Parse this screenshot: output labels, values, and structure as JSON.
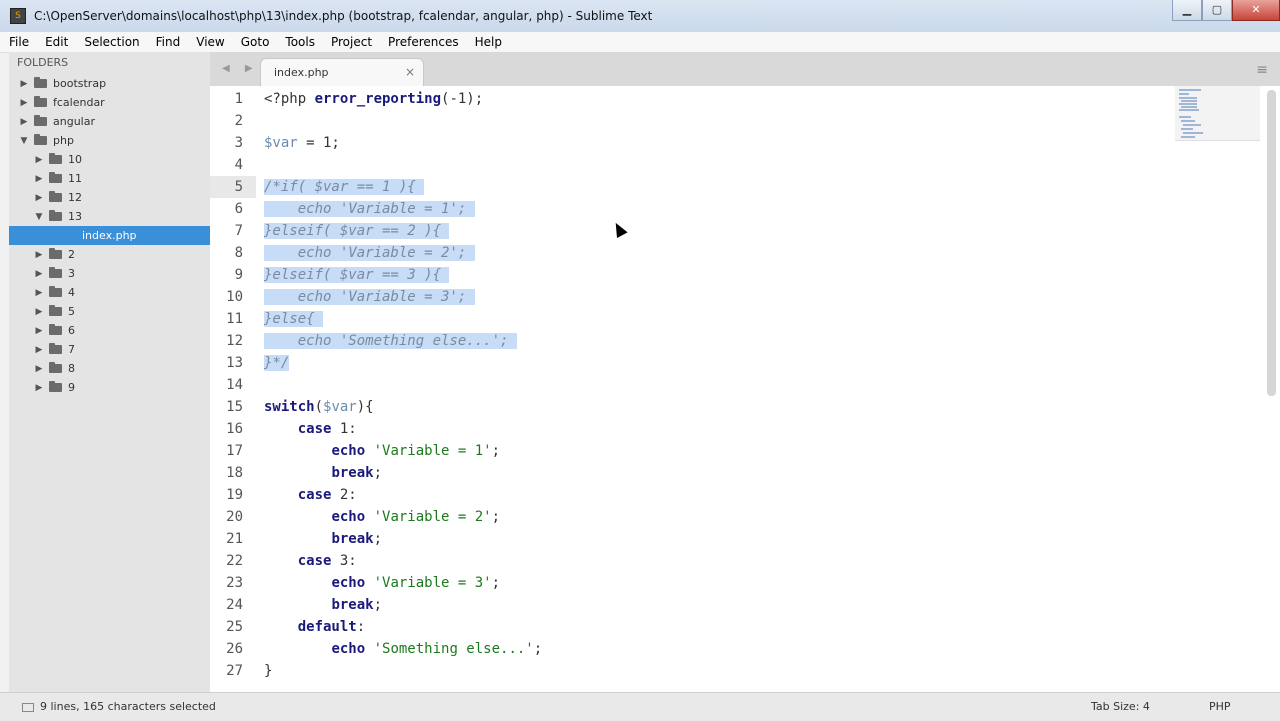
{
  "window": {
    "title": "C:\\OpenServer\\domains\\localhost\\php\\13\\index.php (bootstrap, fcalendar, angular, php) - Sublime Text",
    "minimize_glyph": "▁",
    "maximize_glyph": "▢",
    "close_glyph": "✕"
  },
  "menu": [
    "File",
    "Edit",
    "Selection",
    "Find",
    "View",
    "Goto",
    "Tools",
    "Project",
    "Preferences",
    "Help"
  ],
  "sidebar": {
    "header": "FOLDERS",
    "items": [
      {
        "label": "bootstrap",
        "level": 0,
        "expanded": false,
        "type": "folder"
      },
      {
        "label": "fcalendar",
        "level": 0,
        "expanded": false,
        "type": "folder"
      },
      {
        "label": "angular",
        "level": 0,
        "expanded": false,
        "type": "folder"
      },
      {
        "label": "php",
        "level": 0,
        "expanded": true,
        "type": "folder"
      },
      {
        "label": "10",
        "level": 1,
        "expanded": false,
        "type": "folder"
      },
      {
        "label": "11",
        "level": 1,
        "expanded": false,
        "type": "folder"
      },
      {
        "label": "12",
        "level": 1,
        "expanded": false,
        "type": "folder"
      },
      {
        "label": "13",
        "level": 1,
        "expanded": true,
        "type": "folder"
      },
      {
        "label": "index.php",
        "level": 2,
        "type": "file",
        "selected": true
      },
      {
        "label": "2",
        "level": 1,
        "expanded": false,
        "type": "folder"
      },
      {
        "label": "3",
        "level": 1,
        "expanded": false,
        "type": "folder"
      },
      {
        "label": "4",
        "level": 1,
        "expanded": false,
        "type": "folder"
      },
      {
        "label": "5",
        "level": 1,
        "expanded": false,
        "type": "folder"
      },
      {
        "label": "6",
        "level": 1,
        "expanded": false,
        "type": "folder"
      },
      {
        "label": "7",
        "level": 1,
        "expanded": false,
        "type": "folder"
      },
      {
        "label": "8",
        "level": 1,
        "expanded": false,
        "type": "folder"
      },
      {
        "label": "9",
        "level": 1,
        "expanded": false,
        "type": "folder"
      }
    ]
  },
  "tabs": [
    {
      "label": "index.php",
      "close": "×"
    }
  ],
  "tabbar": {
    "nav_arrows": "◀ ▶",
    "menu_glyph": "≡"
  },
  "editor": {
    "active_line": 5,
    "lines": [
      {
        "n": "1",
        "t": [
          [
            "n",
            "<?php "
          ],
          [
            "k",
            "error_reporting"
          ],
          [
            "n",
            "(-1);"
          ]
        ]
      },
      {
        "n": "2",
        "t": []
      },
      {
        "n": "3",
        "t": [
          [
            "v",
            "$var"
          ],
          [
            "n",
            " = 1;"
          ]
        ]
      },
      {
        "n": "4",
        "t": []
      },
      {
        "n": "5",
        "sel": true,
        "t": [
          [
            "c",
            "/*if( $var == 1 ){ "
          ]
        ]
      },
      {
        "n": "6",
        "sel": true,
        "t": [
          [
            "c",
            "    echo 'Variable = 1'; "
          ]
        ]
      },
      {
        "n": "7",
        "sel": true,
        "t": [
          [
            "c",
            "}elseif( $var == 2 ){ "
          ]
        ]
      },
      {
        "n": "8",
        "sel": true,
        "t": [
          [
            "c",
            "    echo 'Variable = 2'; "
          ]
        ]
      },
      {
        "n": "9",
        "sel": true,
        "t": [
          [
            "c",
            "}elseif( $var == 3 ){ "
          ]
        ]
      },
      {
        "n": "10",
        "sel": true,
        "t": [
          [
            "c",
            "    echo 'Variable = 3'; "
          ]
        ]
      },
      {
        "n": "11",
        "sel": true,
        "t": [
          [
            "c",
            "}else{ "
          ]
        ]
      },
      {
        "n": "12",
        "sel": true,
        "t": [
          [
            "c",
            "    echo 'Something else...'; "
          ]
        ]
      },
      {
        "n": "13",
        "sel": true,
        "t": [
          [
            "c",
            "}*/"
          ]
        ]
      },
      {
        "n": "14",
        "t": []
      },
      {
        "n": "15",
        "t": [
          [
            "k",
            "switch"
          ],
          [
            "n",
            "("
          ],
          [
            "v",
            "$var"
          ],
          [
            "n",
            "){"
          ]
        ]
      },
      {
        "n": "16",
        "t": [
          [
            "n",
            "    "
          ],
          [
            "k",
            "case"
          ],
          [
            "n",
            " 1:"
          ]
        ]
      },
      {
        "n": "17",
        "t": [
          [
            "n",
            "        "
          ],
          [
            "k",
            "echo"
          ],
          [
            "n",
            " "
          ],
          [
            "s",
            "'Variable = 1'"
          ],
          [
            "n",
            ";"
          ]
        ]
      },
      {
        "n": "18",
        "t": [
          [
            "n",
            "        "
          ],
          [
            "k",
            "break"
          ],
          [
            "n",
            ";"
          ]
        ]
      },
      {
        "n": "19",
        "t": [
          [
            "n",
            "    "
          ],
          [
            "k",
            "case"
          ],
          [
            "n",
            " 2:"
          ]
        ]
      },
      {
        "n": "20",
        "t": [
          [
            "n",
            "        "
          ],
          [
            "k",
            "echo"
          ],
          [
            "n",
            " "
          ],
          [
            "s",
            "'Variable = 2'"
          ],
          [
            "n",
            ";"
          ]
        ]
      },
      {
        "n": "21",
        "t": [
          [
            "n",
            "        "
          ],
          [
            "k",
            "break"
          ],
          [
            "n",
            ";"
          ]
        ]
      },
      {
        "n": "22",
        "t": [
          [
            "n",
            "    "
          ],
          [
            "k",
            "case"
          ],
          [
            "n",
            " 3:"
          ]
        ]
      },
      {
        "n": "23",
        "t": [
          [
            "n",
            "        "
          ],
          [
            "k",
            "echo"
          ],
          [
            "n",
            " "
          ],
          [
            "s",
            "'Variable = 3'"
          ],
          [
            "n",
            ";"
          ]
        ]
      },
      {
        "n": "24",
        "t": [
          [
            "n",
            "        "
          ],
          [
            "k",
            "break"
          ],
          [
            "n",
            ";"
          ]
        ]
      },
      {
        "n": "25",
        "t": [
          [
            "n",
            "    "
          ],
          [
            "k",
            "default"
          ],
          [
            "n",
            ":"
          ]
        ]
      },
      {
        "n": "26",
        "t": [
          [
            "n",
            "        "
          ],
          [
            "k",
            "echo"
          ],
          [
            "n",
            " "
          ],
          [
            "s",
            "'Something else...'"
          ],
          [
            "n",
            ";"
          ]
        ]
      },
      {
        "n": "27",
        "t": [
          [
            "n",
            "}"
          ]
        ]
      }
    ]
  },
  "status": {
    "selection": "9 lines, 165 characters selected",
    "tab_size": "Tab Size: 4",
    "syntax": "PHP"
  },
  "colors": {
    "keyword": "#1a1a7a",
    "variable": "#6a8caf",
    "string": "#1c7a1c",
    "comment": "#7a8ba0",
    "selection": "#c6dcf7",
    "sidebar_selected": "#3a8fd9"
  }
}
